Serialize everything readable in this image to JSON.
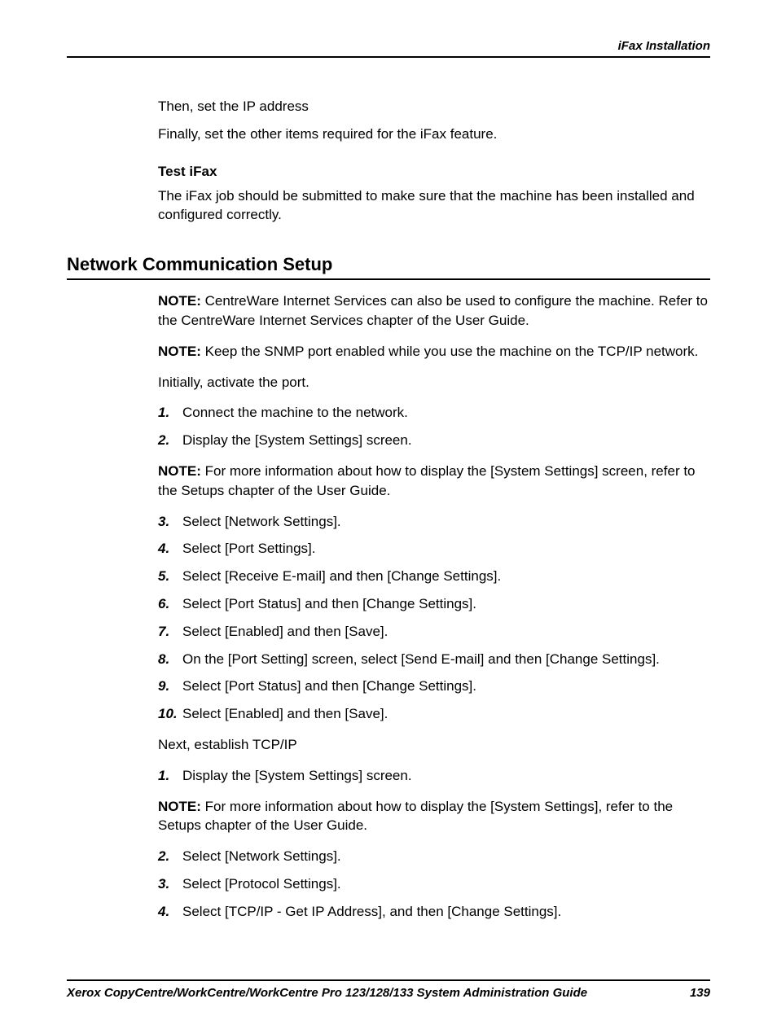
{
  "header": {
    "chapter": "iFax Installation"
  },
  "intro": {
    "line1": "Then, set the IP address",
    "line2": "Finally, set the other items required for the iFax feature.",
    "test_heading": "Test iFax",
    "test_body": "The iFax job should be submitted to make sure that the machine has been installed and configured correctly."
  },
  "section": {
    "title": "Network Communication Setup",
    "note1_label": "NOTE:",
    "note1_text": " CentreWare Internet Services can also be used to configure the machine. Refer to the CentreWare Internet Services chapter of the User Guide.",
    "note2_label": "NOTE:",
    "note2_text": " Keep the SNMP port enabled while you use the machine on the TCP/IP network.",
    "activate_line": "Initially, activate the port.",
    "steps_a": [
      {
        "n": "1.",
        "t": "Connect the machine to the network."
      },
      {
        "n": "2.",
        "t": "Display the [System Settings] screen."
      }
    ],
    "note3_label": "NOTE:",
    "note3_text": " For more information about how to display the [System Settings] screen, refer to the Setups chapter of the User Guide.",
    "steps_b": [
      {
        "n": "3.",
        "t": "Select [Network Settings]."
      },
      {
        "n": "4.",
        "t": "Select [Port Settings]."
      },
      {
        "n": "5.",
        "t": "Select [Receive E-mail] and then [Change Settings]."
      },
      {
        "n": "6.",
        "t": "Select [Port Status] and then [Change Settings]."
      },
      {
        "n": "7.",
        "t": "Select [Enabled] and then [Save]."
      },
      {
        "n": "8.",
        "t": "On the [Port Setting] screen, select [Send E-mail] and then [Change Settings]."
      },
      {
        "n": "9.",
        "t": "Select [Port Status] and then [Change Settings]."
      },
      {
        "n": "10.",
        "t": "Select [Enabled] and then [Save]."
      }
    ],
    "tcpip_line": "Next, establish TCP/IP",
    "steps_c": [
      {
        "n": "1.",
        "t": "Display the [System Settings] screen."
      }
    ],
    "note4_label": "NOTE:",
    "note4_text": " For more information about how to display the [System Settings], refer to the Setups chapter of the User Guide.",
    "steps_d": [
      {
        "n": "2.",
        "t": "Select [Network Settings]."
      },
      {
        "n": "3.",
        "t": "Select [Protocol Settings]."
      },
      {
        "n": "4.",
        "t": "Select [TCP/IP - Get IP Address], and then [Change Settings]."
      }
    ]
  },
  "footer": {
    "title": "Xerox CopyCentre/WorkCentre/WorkCentre Pro 123/128/133 System Administration Guide",
    "page": "139"
  }
}
